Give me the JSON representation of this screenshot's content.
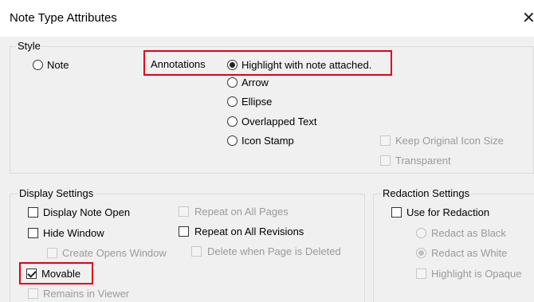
{
  "window": {
    "title": "Note Type Attributes",
    "close_glyph": "✕"
  },
  "style_group": {
    "label": "Style",
    "note_option": "Note",
    "annotations_label": "Annotations",
    "annotation_options": [
      "Highlight with note attached.",
      "Arrow",
      "Ellipse",
      "Overlapped Text",
      "Icon Stamp"
    ],
    "keep_original_icon_size": "Keep Original Icon Size",
    "transparent": "Transparent"
  },
  "display_settings": {
    "label": "Display Settings",
    "display_note_open": "Display Note Open",
    "hide_window": "Hide Window",
    "create_opens_window": "Create Opens Window",
    "movable": "Movable",
    "remains_in_viewer": "Remains in Viewer",
    "repeat_on_all_pages": "Repeat on All Pages",
    "repeat_on_all_revisions": "Repeat on All Revisions",
    "delete_when_page_deleted": "Delete when Page is Deleted"
  },
  "redaction_settings": {
    "label": "Redaction Settings",
    "use_for_redaction": "Use for Redaction",
    "redact_as_black": "Redact as Black",
    "redact_as_white": "Redact as White",
    "highlight_is_opaque": "Highlight is Opaque"
  },
  "colors": {
    "highlight_border": "#e1001a"
  }
}
